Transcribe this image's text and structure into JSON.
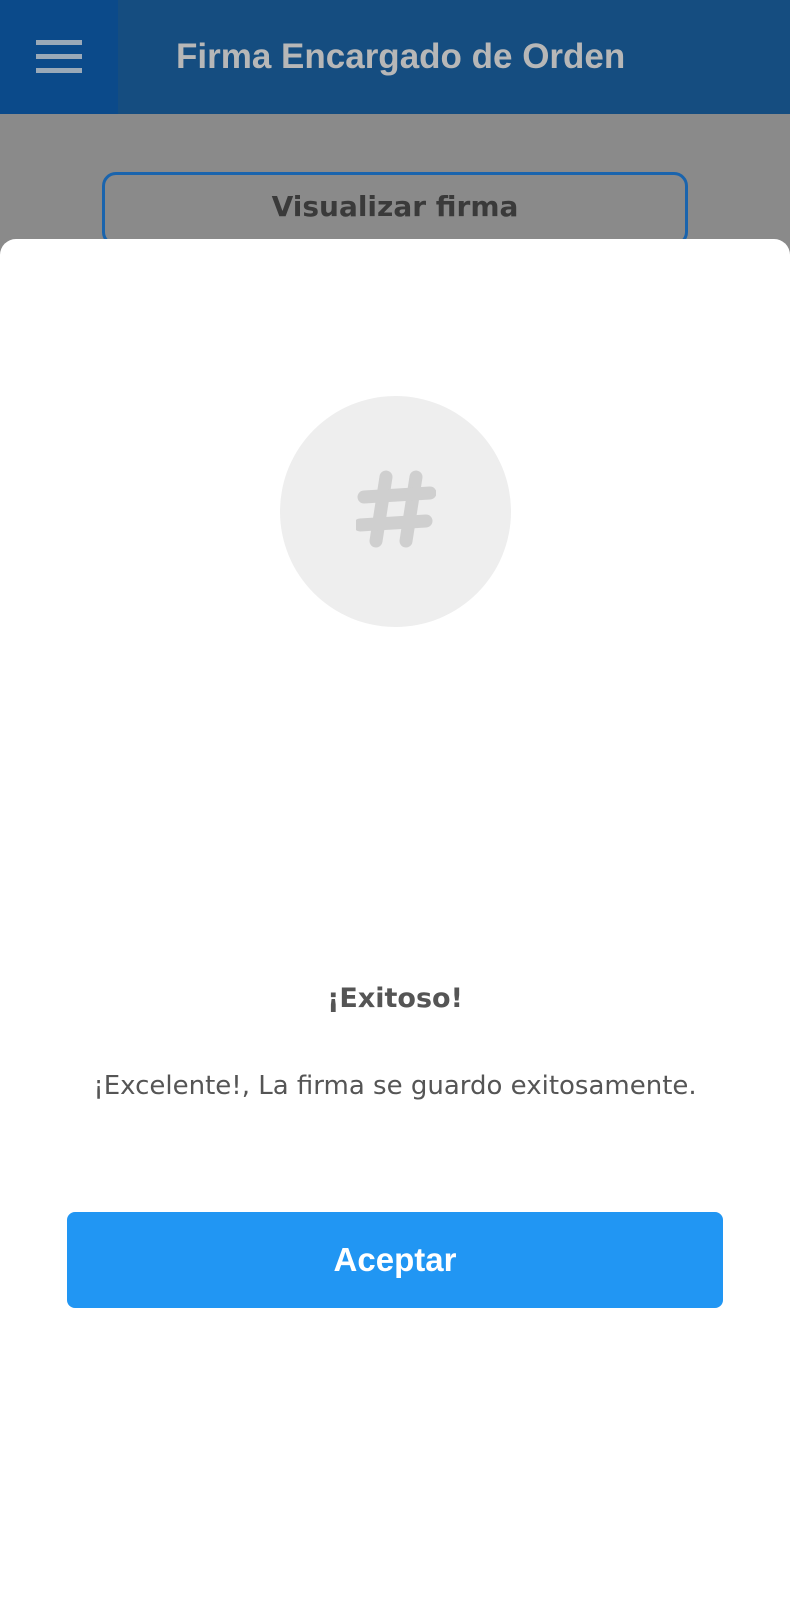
{
  "header": {
    "title": "Firma Encargado de Orden",
    "menu_icon": "menu-icon"
  },
  "page": {
    "visualizar_label": "Visualizar firma"
  },
  "dialog": {
    "icon": "hashtag-icon",
    "title": "¡Exitoso!",
    "message": "¡Excelente!, La firma se guardo exitosamente.",
    "accept_label": "Aceptar"
  },
  "colors": {
    "appbar": "#154d80",
    "menu_button": "#0b4a8a",
    "accent": "#2196f3",
    "scrim": "#8a8a8a"
  }
}
